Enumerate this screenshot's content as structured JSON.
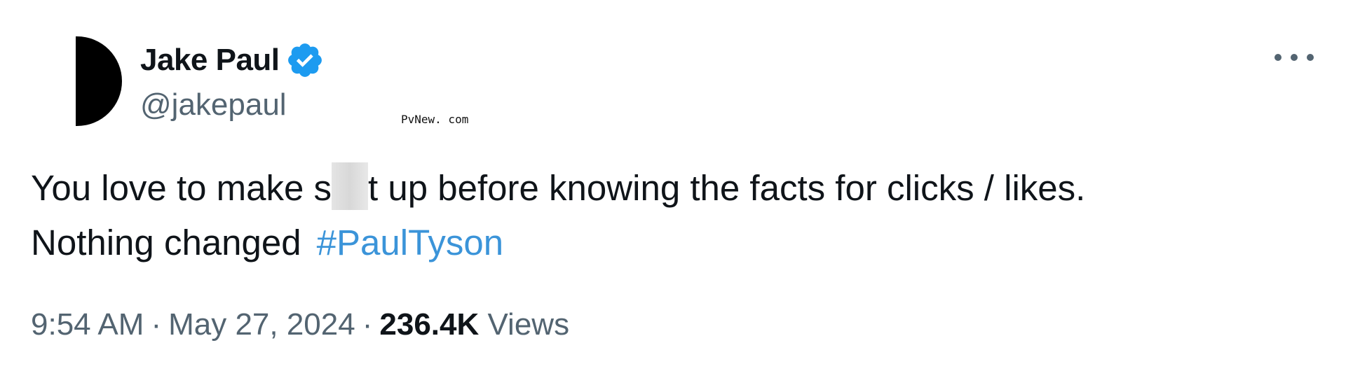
{
  "tweet": {
    "author": {
      "display_name": "Jake Paul",
      "handle": "@jakepaul",
      "verified": true,
      "verified_icon": "verified-badge-icon",
      "verified_color": "#1d9bf0"
    },
    "more_icon": "more-horizontal-icon",
    "text": {
      "line1_before_censor": "You love to make s",
      "line1_after_censor": "t up before knowing the facts for clicks / likes.",
      "line2_text": "Nothing changed",
      "hashtag": "#PaulTyson"
    },
    "meta": {
      "time": "9:54 AM",
      "separator": "·",
      "date": "May 27, 2024",
      "views_count": "236.4K",
      "views_label": "Views"
    }
  },
  "watermark": "PvNew. com",
  "colors": {
    "text_primary": "#0f1419",
    "text_secondary": "#536471",
    "hashtag": "#3b94d9"
  }
}
